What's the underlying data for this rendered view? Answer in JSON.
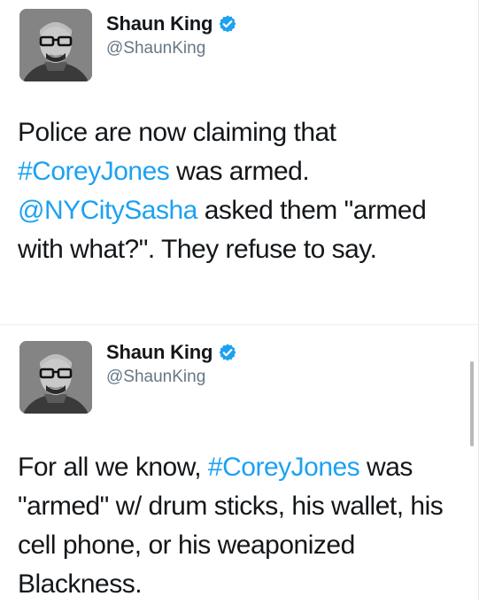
{
  "tweets": [
    {
      "author": {
        "name": "Shaun King",
        "handle": "@ShaunKing",
        "verified": true
      },
      "segments": [
        {
          "type": "text",
          "value": "Police are now claiming that "
        },
        {
          "type": "hashtag",
          "value": "#CoreyJones"
        },
        {
          "type": "text",
          "value": " was armed. "
        },
        {
          "type": "mention",
          "value": "@NYCitySasha"
        },
        {
          "type": "text",
          "value": " asked them \"armed with what?\". They refuse to say."
        }
      ]
    },
    {
      "author": {
        "name": "Shaun King",
        "handle": "@ShaunKing",
        "verified": true
      },
      "segments": [
        {
          "type": "text",
          "value": "For all we know, "
        },
        {
          "type": "hashtag",
          "value": "#CoreyJones"
        },
        {
          "type": "text",
          "value": " was \"armed\" w/ drum sticks, his wallet, his cell phone, or his weaponized Blackness."
        }
      ]
    }
  ],
  "icons": {
    "verified": "verified-badge-icon"
  },
  "colors": {
    "link": "#1da1f2",
    "text": "#14171a",
    "handle": "#657786",
    "verified": "#1da1f2"
  }
}
